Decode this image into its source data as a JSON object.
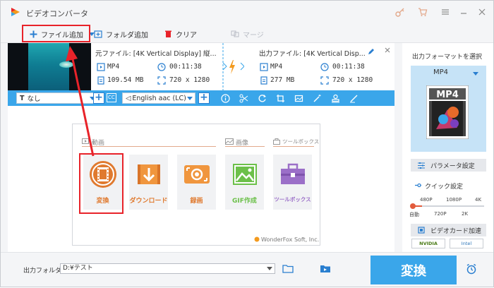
{
  "app": {
    "title": "ビデオコンバータ"
  },
  "toolbar": {
    "add_file": "ファイル追加",
    "add_folder": "フォルダ追加",
    "clear": "クリア",
    "merge": "マージ"
  },
  "file_item": {
    "source_label": "元ファイル: [4K Vertical Display] 縦...",
    "output_label": "出力ファイル: [4K Vertical Disp...",
    "source": {
      "format": "MP4",
      "duration": "00:11:38",
      "size": "109.54 MB",
      "resolution": "720 x 1280"
    },
    "output": {
      "format": "MP4",
      "duration": "00:11:38",
      "size": "277 MB",
      "resolution": "720 x 1280"
    }
  },
  "edit_bar": {
    "subtitle_value": "なし",
    "audio_value": "English aac (LC)",
    "cc_label": "CC"
  },
  "feature_panel": {
    "section_convert": "動画",
    "section_image": "画像",
    "section_tools": "ツールボックス",
    "cards": [
      {
        "label": "変換",
        "icon": "film-icon"
      },
      {
        "label": "ダウンロード",
        "icon": "download-icon"
      },
      {
        "label": "録画",
        "icon": "screen-record-icon"
      },
      {
        "label": "GIF作成",
        "icon": "gif-image-icon"
      },
      {
        "label": "ツールボックス",
        "icon": "toolbox-icon"
      }
    ],
    "brand": "WonderFox Soft, Inc."
  },
  "right_panel": {
    "title": "出力フォーマットを選択",
    "format": "MP4",
    "format_icon_text": "MP4",
    "param_settings": "パラメータ設定",
    "quick_settings": "クイック設定",
    "quality_ticks_top": [
      "480P",
      "1080P",
      "4K"
    ],
    "quality_ticks_bottom": [
      "自動",
      "720P",
      "2K"
    ],
    "quality_level": "自動",
    "gpu_accel": "ビデオカード加速",
    "gpu_nvidia": "NVIDIA",
    "gpu_intel": "Intel"
  },
  "bottom": {
    "output_folder_label": "出力フォルダ：",
    "output_folder_value": "D:¥テスト",
    "convert_button": "変換"
  },
  "colors": {
    "accent_blue": "#3aa6ea",
    "highlight_red": "#e8232a",
    "feature_orange": "#e07a2f",
    "gif_green": "#6cc04a",
    "toolbox_purple": "#9b6fc8"
  }
}
